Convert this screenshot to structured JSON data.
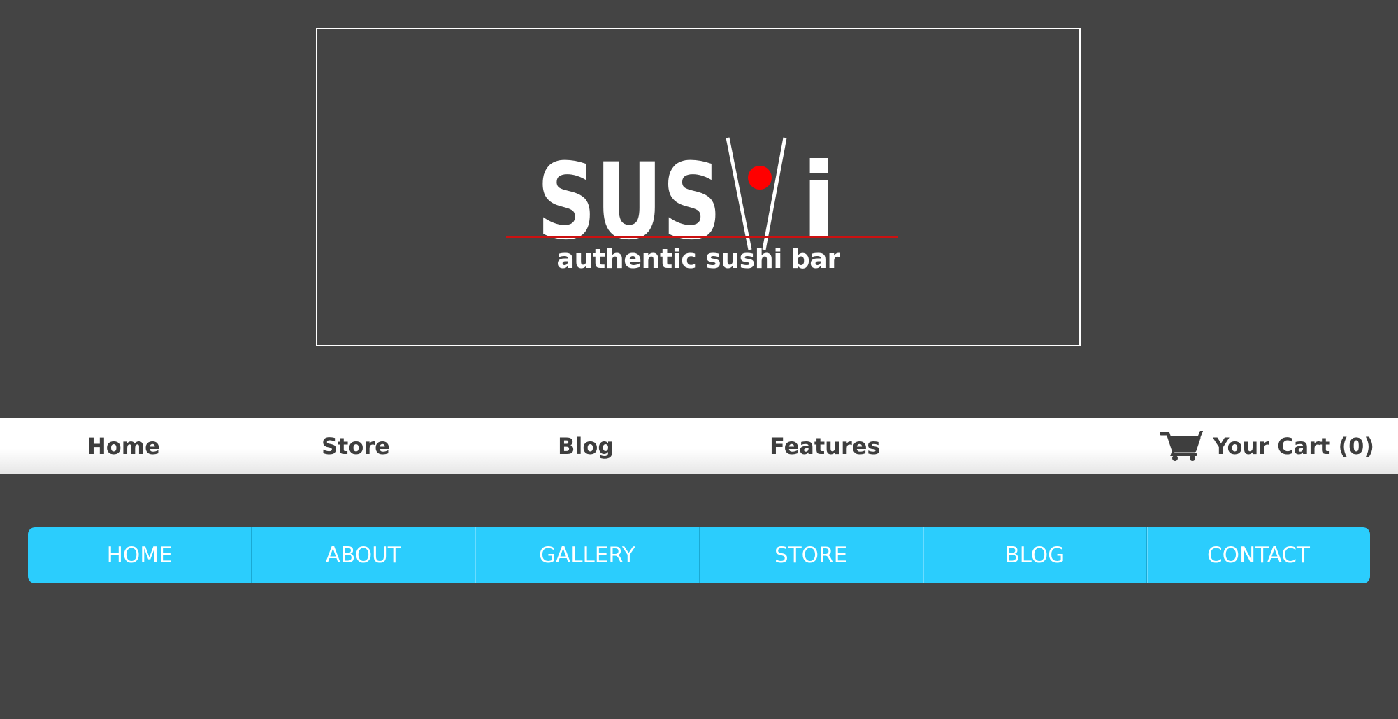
{
  "logo": {
    "wordmark_left": "SUS",
    "wordmark_right": "i",
    "tagline": "authentic sushi bar",
    "accent_color": "#ff0000",
    "underline_color": "#cc1111"
  },
  "top_nav": {
    "items": [
      {
        "label": "Home"
      },
      {
        "label": "Store"
      },
      {
        "label": "Blog"
      },
      {
        "label": "Features"
      }
    ],
    "cart": {
      "icon": "shopping-cart-icon",
      "label": "Your Cart (0)"
    }
  },
  "main_menu": {
    "color": "#2bcdfd",
    "items": [
      {
        "label": "HOME"
      },
      {
        "label": "ABOUT"
      },
      {
        "label": "GALLERY"
      },
      {
        "label": "STORE"
      },
      {
        "label": "BLOG"
      },
      {
        "label": "CONTACT"
      }
    ]
  }
}
